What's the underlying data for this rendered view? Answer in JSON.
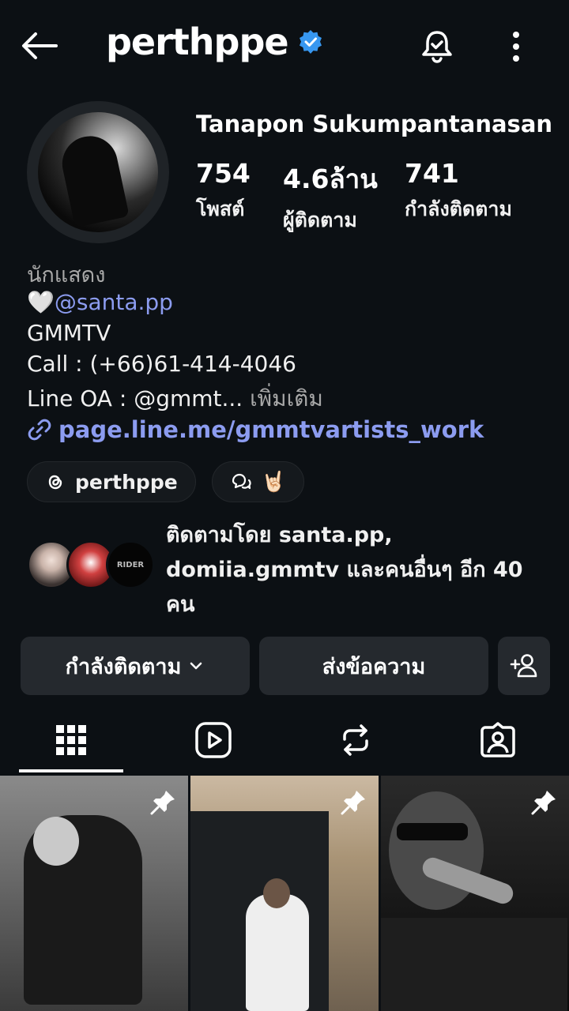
{
  "header": {
    "username": "perthppe",
    "verified": true
  },
  "profile": {
    "full_name": "Tanapon Sukumpantanasan",
    "stats": [
      {
        "value": "754",
        "label": "โพสต์"
      },
      {
        "value": "4.6ล้าน",
        "label": "ผู้ติดตาม"
      },
      {
        "value": "741",
        "label": "กำลังติดตาม"
      }
    ]
  },
  "bio": {
    "category": "นักแสดง",
    "line1_emoji": "🤍",
    "line1_mention": "@santa.pp",
    "line2": "GMMTV",
    "line3": "Call : (+66)61-414-4046",
    "line4": "Line OA : @gmmt...",
    "line4_more": "เพิ่มเติม",
    "link": "page.line.me/gmmtvartists_work"
  },
  "chips": {
    "threads_handle": "perthppe",
    "note_emoji": "🤘🏻"
  },
  "followed_by": {
    "text": "ติดตามโดย santa.pp, domiia.gmmtv และคนอื่นๆ อีก 40 คน",
    "mini3_label": "RIDER"
  },
  "actions": {
    "following_label": "กำลังติดตาม",
    "message_label": "ส่งข้อความ"
  },
  "colors": {
    "background": "#0c1014",
    "accent_link": "#8c9cf0",
    "button": "#25292e",
    "verified": "#3797f0"
  }
}
